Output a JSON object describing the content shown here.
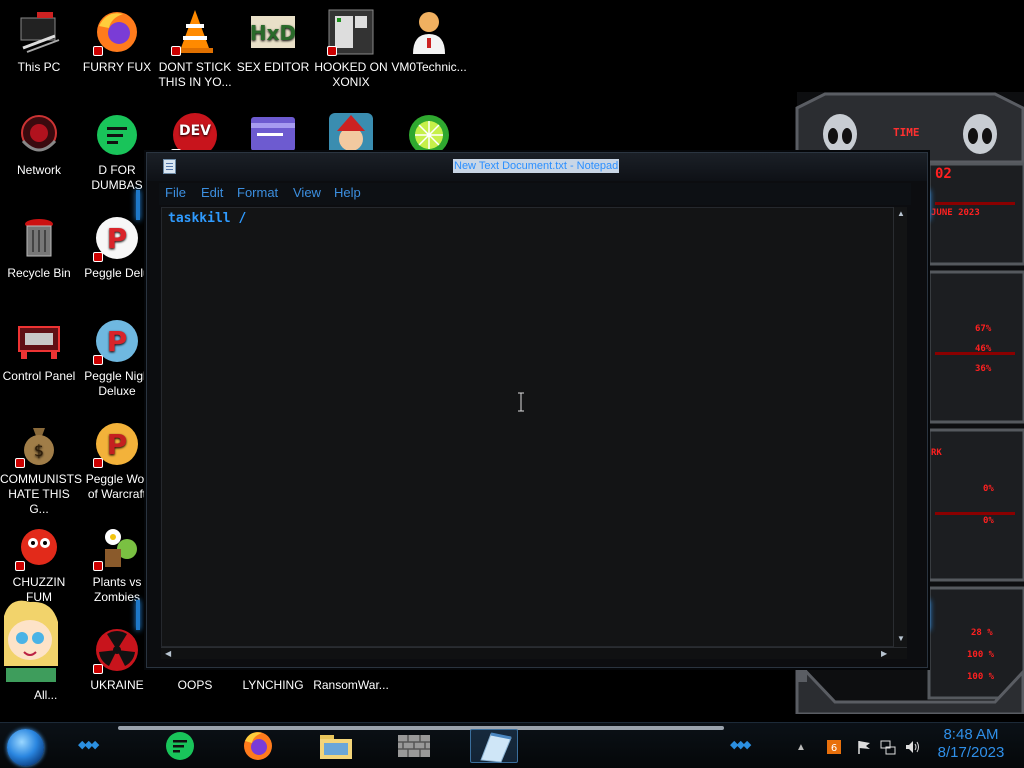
{
  "desktop": {
    "icons": [
      {
        "label": "This PC"
      },
      {
        "label": "FURRY FUX"
      },
      {
        "label": "DONT STICK\nTHIS IN YO..."
      },
      {
        "label": "SEX EDITOR"
      },
      {
        "label": "HOOKED ON\nXONIX"
      },
      {
        "label": "VM0Technic..."
      },
      {
        "label": "Network"
      },
      {
        "label": "D FOR\nDUMBAS"
      },
      {
        "label": "Recycle Bin"
      },
      {
        "label": "Peggle Delu"
      },
      {
        "label": "Control Panel"
      },
      {
        "label": "Peggle Nigh\nDeluxe"
      },
      {
        "label": "COMMUNISTS\nHATE THIS G..."
      },
      {
        "label": "Peggle Wor\nof Warcraft"
      },
      {
        "label": "CHUZZIN\nFUM"
      },
      {
        "label": "Plants vs\nZombies"
      },
      {
        "label": "All..."
      },
      {
        "label": "UKRAINE"
      },
      {
        "label": "OOPS"
      },
      {
        "label": "LYNCHING"
      },
      {
        "label": "RansomWar..."
      }
    ]
  },
  "notepad": {
    "title": "New Text Document.txt - Notepad",
    "menu": [
      "File",
      "Edit",
      "Format",
      "View",
      "Help"
    ],
    "content": "taskkill /"
  },
  "gadget": {
    "values": [
      "67%",
      "46%",
      "36%",
      "0%",
      "0%",
      "28 %",
      "100 %",
      "100 %"
    ],
    "labels": [
      "TIME",
      "02",
      "JUNE 2023",
      "RK"
    ]
  },
  "taskbar": {
    "time": "8:48 AM",
    "date": "8/17/2023"
  },
  "colors": {
    "accent_blue": "#2f8fe8",
    "gadget_red": "#ff2020",
    "desktop_bg": "#000000"
  }
}
